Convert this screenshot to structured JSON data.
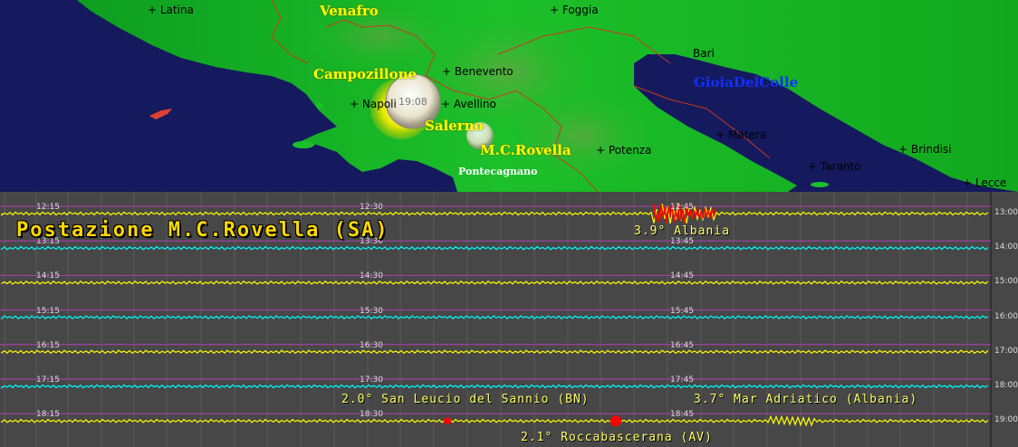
{
  "map": {
    "cities": [
      {
        "name": "+ Latina"
      },
      {
        "name": "+ Foggia"
      },
      {
        "name": "+ Benevento"
      },
      {
        "name": "Bari"
      },
      {
        "name": "+ Napoli"
      },
      {
        "name": "+ Avellino"
      },
      {
        "name": "+ Matera"
      },
      {
        "name": "+ Potenza"
      },
      {
        "name": "+ Brindisi"
      },
      {
        "name": "+ Taranto"
      },
      {
        "name": "+ Lecce"
      }
    ],
    "stations": [
      {
        "name": "Venafro",
        "style": "yellow"
      },
      {
        "name": "Campozillone",
        "style": "yellow"
      },
      {
        "name": "Salerno",
        "style": "yellow"
      },
      {
        "name": "M.C.Rovella",
        "style": "yellow"
      },
      {
        "name": "Pontecagnano",
        "style": "white"
      },
      {
        "name": "GioiaDelColle",
        "style": "blue"
      }
    ],
    "clock": "19:08"
  },
  "drum": {
    "station_title": "Postazione M.C.Rovella (SA)",
    "rows": [
      {
        "times": [
          "12:15",
          "12:30",
          "12:45"
        ],
        "end": "13:00",
        "color": "#ffff00"
      },
      {
        "times": [
          "13:15",
          "13:30",
          "13:45"
        ],
        "end": "14:00",
        "color": "#00ffff"
      },
      {
        "times": [
          "14:15",
          "14:30",
          "14:45"
        ],
        "end": "15:00",
        "color": "#ffff00"
      },
      {
        "times": [
          "15:15",
          "15:30",
          "15:45"
        ],
        "end": "16:00",
        "color": "#00ffff"
      },
      {
        "times": [
          "16:15",
          "16:30",
          "16:45"
        ],
        "end": "17:00",
        "color": "#ffff00"
      },
      {
        "times": [
          "17:15",
          "17:30",
          "17:45"
        ],
        "end": "18:00",
        "color": "#00ffff"
      },
      {
        "times": [
          "18:15",
          "18:30",
          "18:45"
        ],
        "end": "19:00",
        "color": "#ffff00"
      }
    ],
    "events": [
      {
        "label": "3.9° Albania"
      },
      {
        "label": "2.0° San Leucio del Sannio (BN)"
      },
      {
        "label": "3.7° Mar Adriatico (Albania)"
      },
      {
        "label": "2.1° Roccabascerana (AV)"
      }
    ],
    "colors": {
      "background": "#474747",
      "grid": "#b040b0",
      "event": "#ff0000"
    }
  }
}
